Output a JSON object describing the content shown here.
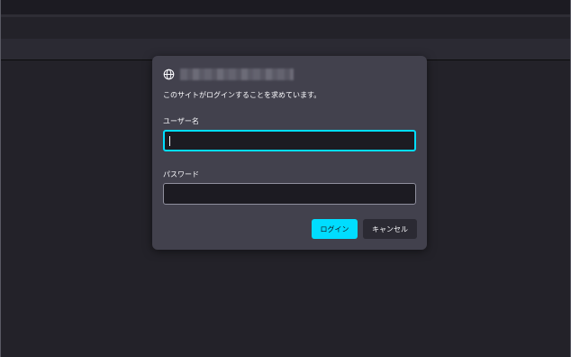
{
  "dialog": {
    "origin_icon": "globe-icon",
    "message": "このサイトがログインすることを求めています。",
    "username_label": "ユーザー名",
    "username_value": "",
    "password_label": "パスワード",
    "password_value": "",
    "login_button": "ログイン",
    "cancel_button": "キャンセル"
  },
  "colors": {
    "accent": "#00ddff",
    "dialog_bg": "#42414d",
    "field_bg": "#1c1b22",
    "text": "#fbfbfe"
  }
}
